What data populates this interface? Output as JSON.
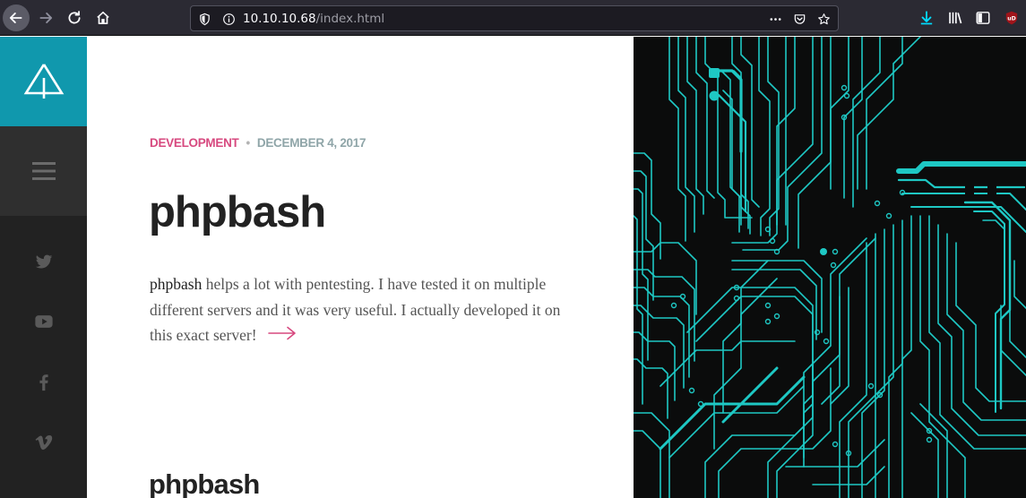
{
  "browser": {
    "url_host": "10.10.10.68",
    "url_path": "/index.html"
  },
  "sidebar": {
    "logo": "tree-logo-icon",
    "menu": "hamburger-icon",
    "social": [
      "twitter-icon",
      "youtube-icon",
      "facebook-icon",
      "vimeo-icon"
    ]
  },
  "post": {
    "category": "DEVELOPMENT",
    "date": "DECEMBER 4, 2017",
    "title": "phpbash",
    "excerpt_strong": "phpbash",
    "excerpt_rest": " helps a lot with pentesting. I have tested it on multiple different servers and it was very useful. I actually developed it on this exact server!"
  },
  "next_post": {
    "title": "phpbash"
  },
  "colors": {
    "accent": "#1098ad",
    "category": "#d7497f",
    "date": "#8fa5a8",
    "circuit": "#1ec8c4"
  }
}
